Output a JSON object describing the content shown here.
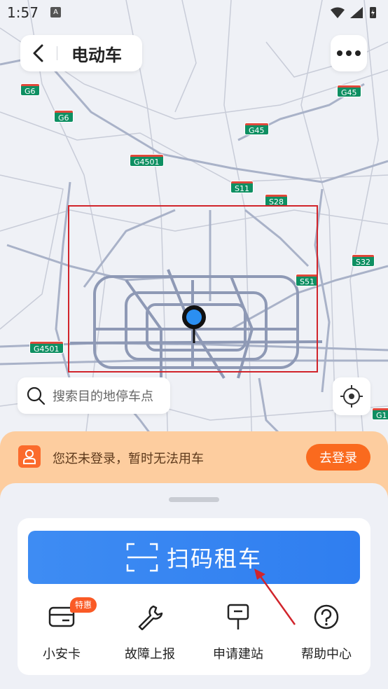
{
  "status_bar": {
    "time": "1:57",
    "notification_icon": "A"
  },
  "header": {
    "title": "电动车",
    "back_icon": "chevron-left-icon",
    "more_icon": "more-dots-icon"
  },
  "map": {
    "road_labels": [
      "G6",
      "G6",
      "G45",
      "G45",
      "G4501",
      "S11",
      "S28",
      "S32",
      "S51",
      "G4501",
      "G1"
    ],
    "shield_color": "#0e8f62"
  },
  "search": {
    "placeholder": "搜索目的地停车点"
  },
  "login_banner": {
    "message": "您还未登录，暂时无法用车",
    "button_label": "去登录"
  },
  "scan": {
    "label": "扫码租车"
  },
  "quick_actions": [
    {
      "label": "小安卡",
      "icon": "card-icon",
      "badge": "特惠"
    },
    {
      "label": "故障上报",
      "icon": "wrench-icon"
    },
    {
      "label": "申请建站",
      "icon": "signpost-icon"
    },
    {
      "label": "帮助中心",
      "icon": "help-icon"
    }
  ],
  "colors": {
    "accent_blue": "#2f7ef0",
    "orange": "#fa6a1e",
    "banner": "#fdcd9f",
    "annotation_red": "#d1242b"
  }
}
